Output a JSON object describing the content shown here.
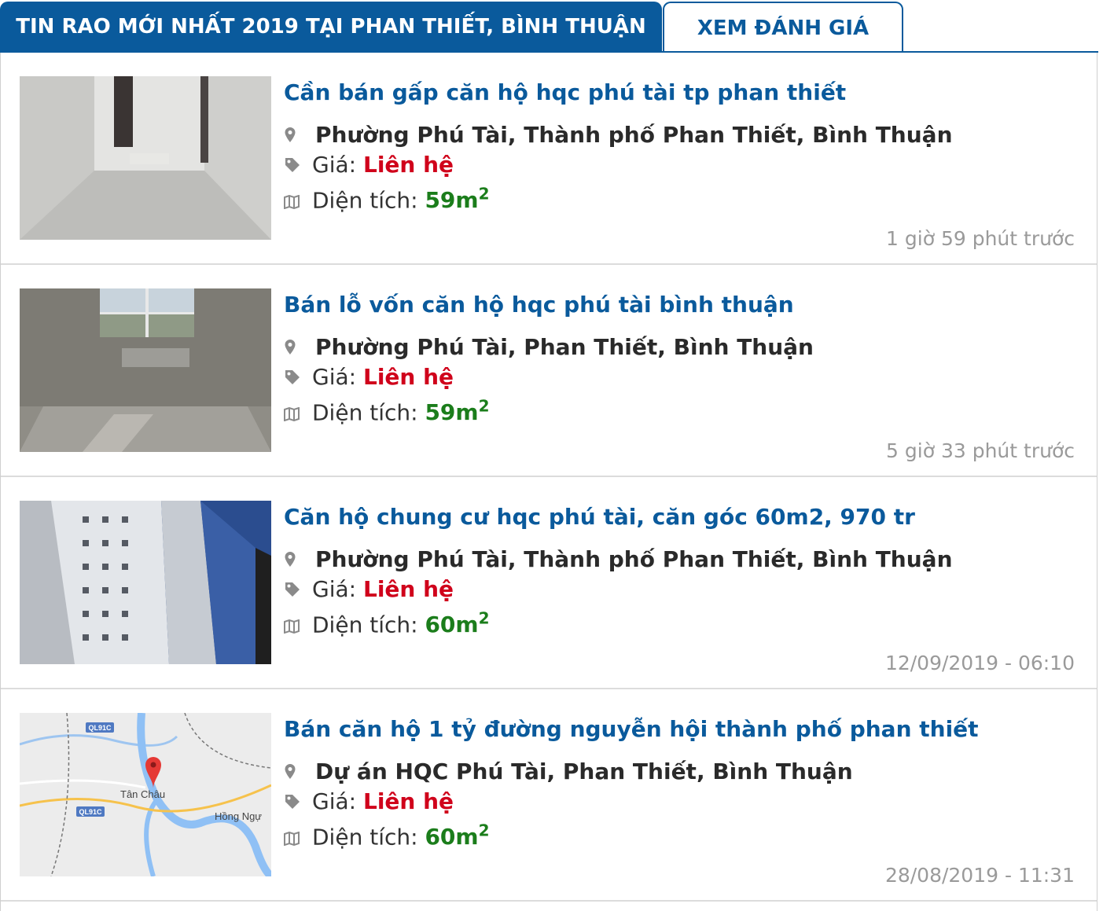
{
  "tabs": {
    "active_label": "TIN RAO MỚI NHẤT 2019 TẠI PHAN THIẾT, BÌNH THUẬN",
    "inactive_label": "XEM ĐÁNH GIÁ"
  },
  "listings": [
    {
      "title": "Cần bán gấp căn hộ hqc phú tài tp phan thiết",
      "address": "Phường Phú Tài, Thành phố Phan Thiết, Bình Thuận",
      "price_label": "Giá:",
      "price": "Liên hệ",
      "area_label": "Diện tích:",
      "area": "59m",
      "area_unit_sup": "2",
      "time": "1 giờ 59 phút trước"
    },
    {
      "title": "Bán lỗ vốn căn hộ hqc phú tài bình thuận",
      "address": "Phường Phú Tài, Phan Thiết, Bình Thuận",
      "price_label": "Giá:",
      "price": "Liên hệ",
      "area_label": "Diện tích:",
      "area": "59m",
      "area_unit_sup": "2",
      "time": "5 giờ 33 phút trước"
    },
    {
      "title": "Căn hộ chung cư hqc phú tài, căn góc 60m2, 970 tr",
      "address": "Phường Phú Tài, Thành phố Phan Thiết, Bình Thuận",
      "price_label": "Giá:",
      "price": "Liên hệ",
      "area_label": "Diện tích:",
      "area": "60m",
      "area_unit_sup": "2",
      "time": "12/09/2019 - 06:10"
    },
    {
      "title": "Bán căn hộ 1 tỷ đường nguyễn hội thành phố phan thiết",
      "address": "Dự án HQC Phú Tài, Phan Thiết, Bình Thuận",
      "price_label": "Giá:",
      "price": "Liên hệ",
      "area_label": "Diện tích:",
      "area": "60m",
      "area_unit_sup": "2",
      "time": "28/08/2019 - 11:31",
      "map_labels": {
        "road1": "QL91C",
        "road2": "QL91C",
        "town1": "Tân Châu",
        "town2": "Hồng Ngự"
      }
    }
  ],
  "icons": {
    "location": "map-pin-icon",
    "price": "tag-icon",
    "area": "map-area-icon"
  },
  "colors": {
    "brand_blue": "#0a5a9c",
    "price_red": "#d0021b",
    "area_green": "#1b7d1b"
  }
}
